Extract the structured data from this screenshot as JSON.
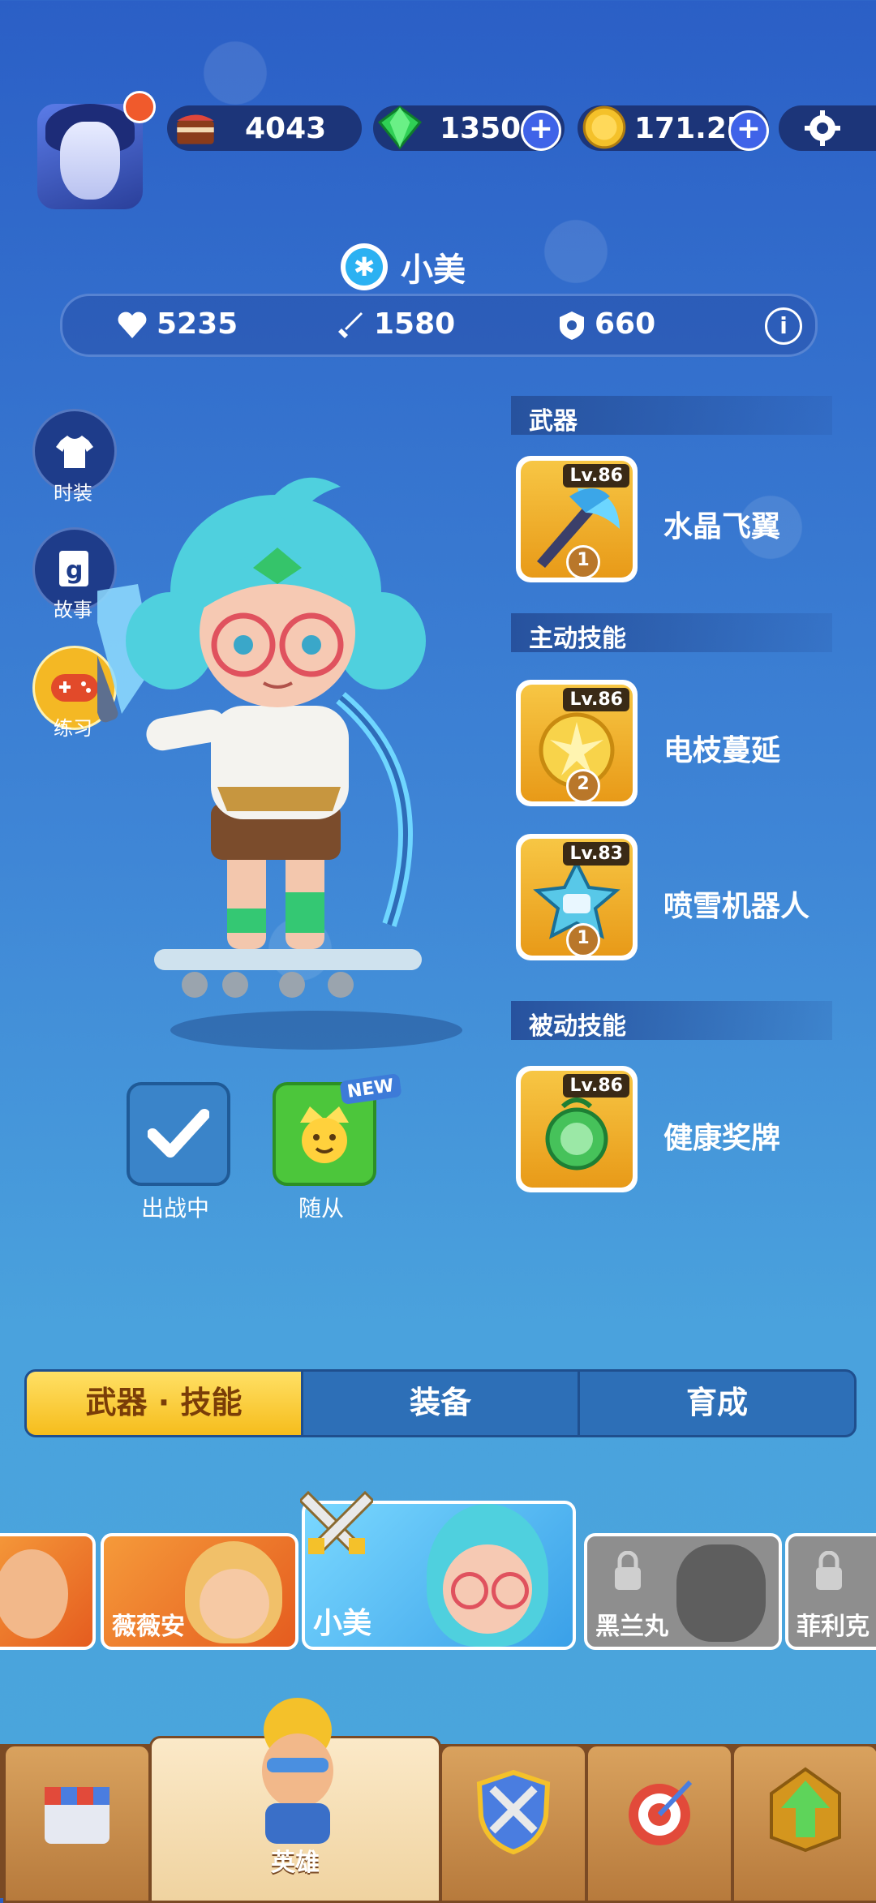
{
  "currencies": {
    "cake": "4043",
    "gems": "1350",
    "coins": "171.2K"
  },
  "hero": {
    "name": "小美",
    "stats": {
      "health": "5235",
      "attack": "1580",
      "defense": "660"
    }
  },
  "side_buttons": {
    "costume": "时装",
    "story": "故事",
    "practice": "练习"
  },
  "sections": {
    "weapon": "武器",
    "active_skills": "主动技能",
    "passive_skills": "被动技能"
  },
  "weapon": {
    "level": "Lv.86",
    "badge": "1",
    "name": "水晶飞翼"
  },
  "active_skills": [
    {
      "level": "Lv.86",
      "badge": "2",
      "name": "电枝蔓延"
    },
    {
      "level": "Lv.83",
      "badge": "1",
      "name": "喷雪机器人"
    }
  ],
  "passive_skills": [
    {
      "level": "Lv.86",
      "name": "健康奖牌"
    }
  ],
  "actions": {
    "deployed": "出战中",
    "follower": "随从",
    "new_tag": "NEW"
  },
  "tabs": [
    "武器 · 技能",
    "装备",
    "育成"
  ],
  "hero_cards": {
    "vivian": "薇薇安",
    "xiaomei": "小美",
    "kuromaru": "黑兰丸",
    "felix": "菲利克"
  },
  "nav": {
    "heroes": "英雄"
  },
  "colors": {
    "accent_yellow": "#f6bd1c",
    "panel_blue": "#1c3579",
    "card_gold": "#f7c644"
  }
}
